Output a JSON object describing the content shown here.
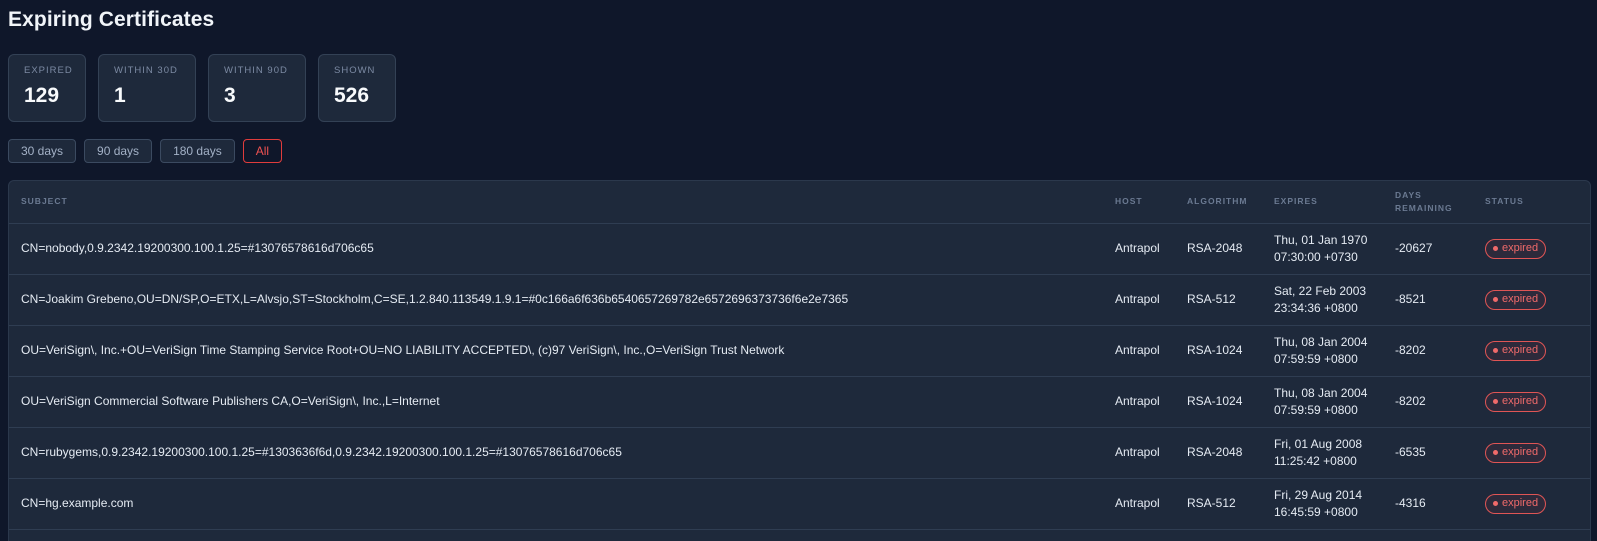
{
  "page": {
    "title": "Expiring Certificates"
  },
  "stats": [
    {
      "label": "EXPIRED",
      "value": "129"
    },
    {
      "label": "WITHIN 30D",
      "value": "1"
    },
    {
      "label": "WITHIN 90D",
      "value": "3"
    },
    {
      "label": "SHOWN",
      "value": "526"
    }
  ],
  "filters": {
    "options": [
      "30 days",
      "90 days",
      "180 days",
      "All"
    ],
    "active": "All"
  },
  "colors": {
    "background": "#0f172a",
    "panel": "#1e293b",
    "accent_red": "#f05252"
  },
  "table": {
    "headers": {
      "subject": "SUBJECT",
      "host": "HOST",
      "algorithm": "ALGORITHM",
      "expires": "EXPIRES",
      "days_line1": "DAYS",
      "days_line2": "REMAINING",
      "status": "STATUS"
    },
    "rows": [
      {
        "subject": "CN=nobody,0.9.2342.19200300.100.1.25=#13076578616d706c65",
        "host": "Antrapol",
        "algorithm": "RSA-2048",
        "expires_date": "Thu, 01 Jan 1970",
        "expires_time": "07:30:00 +0730",
        "days": "-20627",
        "status": "expired"
      },
      {
        "subject": "CN=Joakim Grebeno,OU=DN/SP,O=ETX,L=Alvsjo,ST=Stockholm,C=SE,1.2.840.113549.1.9.1=#0c166a6f636b6540657269782e6572696373736f6e2e7365",
        "host": "Antrapol",
        "algorithm": "RSA-512",
        "expires_date": "Sat, 22 Feb 2003",
        "expires_time": "23:34:36 +0800",
        "days": "-8521",
        "status": "expired"
      },
      {
        "subject": "OU=VeriSign\\, Inc.+OU=VeriSign Time Stamping Service Root+OU=NO LIABILITY ACCEPTED\\, (c)97 VeriSign\\, Inc.,O=VeriSign Trust Network",
        "host": "Antrapol",
        "algorithm": "RSA-1024",
        "expires_date": "Thu, 08 Jan 2004",
        "expires_time": "07:59:59 +0800",
        "days": "-8202",
        "status": "expired"
      },
      {
        "subject": "OU=VeriSign Commercial Software Publishers CA,O=VeriSign\\, Inc.,L=Internet",
        "host": "Antrapol",
        "algorithm": "RSA-1024",
        "expires_date": "Thu, 08 Jan 2004",
        "expires_time": "07:59:59 +0800",
        "days": "-8202",
        "status": "expired"
      },
      {
        "subject": "CN=rubygems,0.9.2342.19200300.100.1.25=#1303636f6d,0.9.2342.19200300.100.1.25=#13076578616d706c65",
        "host": "Antrapol",
        "algorithm": "RSA-2048",
        "expires_date": "Fri, 01 Aug 2008",
        "expires_time": "11:25:42 +0800",
        "days": "-6535",
        "status": "expired"
      },
      {
        "subject": "CN=hg.example.com",
        "host": "Antrapol",
        "algorithm": "RSA-512",
        "expires_date": "Fri, 29 Aug 2014",
        "expires_time": "16:45:59 +0800",
        "days": "-4316",
        "status": "expired"
      }
    ]
  }
}
